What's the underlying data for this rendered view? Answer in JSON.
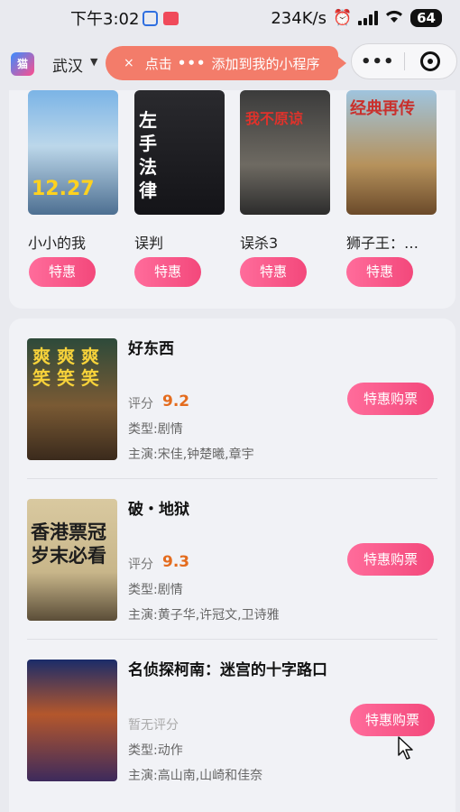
{
  "status_bar": {
    "time": "下午3:02",
    "speed": "234K/s",
    "battery": "64"
  },
  "nav": {
    "logo": "猫",
    "city": "武汉",
    "tip": {
      "close": "×",
      "prefix": "点击",
      "dots": "•••",
      "suffix": "添加到我的小程序"
    },
    "more_glyph": "•••"
  },
  "hot_movies": [
    {
      "name": "小小的我",
      "poster_text": "12.27",
      "button": "特惠"
    },
    {
      "name": "误判",
      "poster_text": "左手 法律",
      "button": "特惠"
    },
    {
      "name": "误杀3",
      "poster_text": "我不原谅",
      "button": "特惠"
    },
    {
      "name": "狮子王：…",
      "poster_text": "经典再传",
      "button": "特惠"
    }
  ],
  "movie_list": [
    {
      "title": "好东西",
      "score_label": "评分",
      "score": "9.2",
      "genre": "类型:剧情",
      "cast": "主演:宋佳,钟楚曦,章宇",
      "poster_text": "爽 爽 爽 笑 笑 笑",
      "button": "特惠购票"
    },
    {
      "title": "破・地狱",
      "score_label": "评分",
      "score": "9.3",
      "genre": "类型:剧情",
      "cast": "主演:黄子华,许冠文,卫诗雅",
      "poster_text": "香港票冠 岁末必看",
      "button": "特惠购票"
    },
    {
      "title": "名侦探柯南：迷宫的十字路口",
      "no_score": "暂无评分",
      "genre": "类型:动作",
      "cast": "主演:高山南,山崎和佳奈",
      "button": "特惠购票"
    }
  ],
  "colors": {
    "accent": "#f3487b",
    "score": "#e46c1e",
    "tip": "#f37c6a"
  }
}
